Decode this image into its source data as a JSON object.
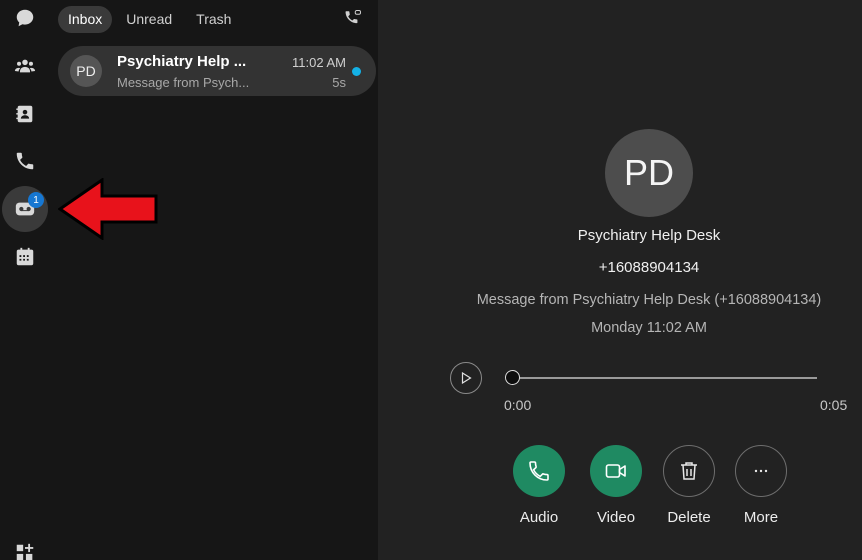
{
  "rail": {
    "items": [
      {
        "name": "chat-icon"
      },
      {
        "name": "teams-icon"
      },
      {
        "name": "contacts-icon"
      },
      {
        "name": "phone-icon"
      },
      {
        "name": "voicemail-icon",
        "badge": "1",
        "active": true
      },
      {
        "name": "calendar-icon"
      },
      {
        "name": "apps-add-icon"
      }
    ]
  },
  "list": {
    "tabs": [
      "Inbox",
      "Unread",
      "Trash"
    ],
    "active_tab": "Inbox",
    "messages": [
      {
        "initials": "PD",
        "name": "Psychiatry Help ...",
        "preview": "Message from Psych...",
        "time": "11:02 AM",
        "duration": "5s",
        "unread": true
      }
    ]
  },
  "detail": {
    "initials": "PD",
    "name": "Psychiatry Help Desk",
    "number": "+16088904134",
    "message": "Message from Psychiatry Help Desk (+16088904134)",
    "datetime": "Monday 11:02 AM",
    "player": {
      "current": "0:00",
      "total": "0:05",
      "progress": 0
    },
    "actions": [
      {
        "label": "Audio",
        "icon": "phone-icon"
      },
      {
        "label": "Video",
        "icon": "video-icon"
      },
      {
        "label": "Delete",
        "icon": "trash-icon"
      },
      {
        "label": "More",
        "icon": "more-icon"
      }
    ]
  },
  "colors": {
    "accent_green": "#1f8a62",
    "badge_blue": "#1677d2",
    "unread_dot": "#14b1e6",
    "annotation_arrow": "#e8121b"
  }
}
